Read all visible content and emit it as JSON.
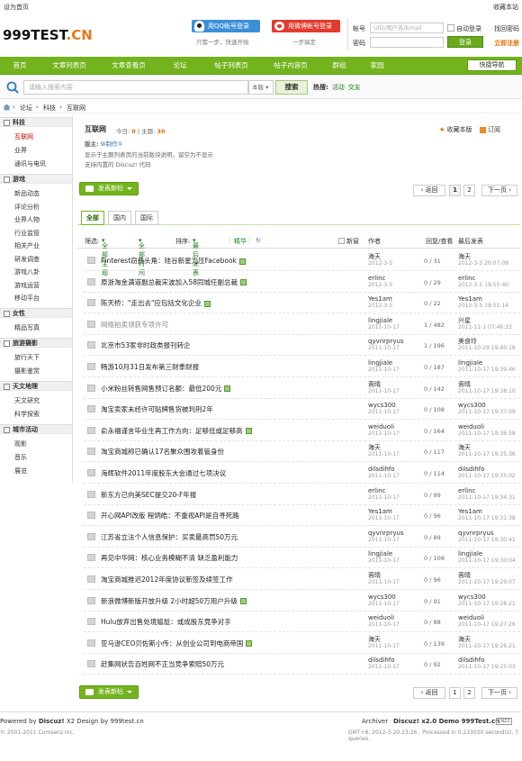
{
  "topbar": {
    "set_home": "设为首页",
    "bookmark": "收藏本站"
  },
  "logo": {
    "main": "999TEST",
    "suffix": ".CN"
  },
  "social": {
    "qq_label": "用QQ帐号登录",
    "qq_sub": "只需一步，快速开始",
    "weibo_label": "用微博帐号登录",
    "weibo_sub": "一步搞定"
  },
  "login": {
    "account_label": "帐号",
    "account_placeholder": "UID/用户名/Email",
    "autologin": "自动登录",
    "forgot": "找回密码",
    "password_label": "密码",
    "login_btn": "登录",
    "register": "立即注册"
  },
  "nav": {
    "items": [
      "首页",
      "文章列表页",
      "文章查看页",
      "论坛",
      "帖子列表页",
      "帖子内容页",
      "群组",
      "家园"
    ],
    "quick": "快捷导航"
  },
  "search": {
    "placeholder": "请输入搜索内容",
    "scope": "本版",
    "button": "搜索",
    "hot_label": "热搜:",
    "hot": [
      "活动",
      "交友"
    ]
  },
  "breadcrumb": [
    "论坛",
    "科技",
    "互联网"
  ],
  "sidebar": {
    "groups": [
      {
        "title": "科技",
        "items": [
          "互联网",
          "业界",
          "通讯与电讯"
        ]
      },
      {
        "title": "游戏",
        "items": [
          "新品动态",
          "评论分析",
          "业界人物",
          "行业监管",
          "相关产业",
          "研发调查",
          "游戏八卦",
          "游戏运营",
          "移动平台"
        ]
      },
      {
        "title": "女性",
        "items": [
          "精品写真"
        ]
      },
      {
        "title": "旅游摄影",
        "items": [
          "旅行天下",
          "摄影鉴赏"
        ]
      },
      {
        "title": "天文地理",
        "items": [
          "天文研究",
          "科学探索"
        ]
      },
      {
        "title": "城市活动",
        "items": [
          "观影",
          "音乐",
          "展览"
        ]
      }
    ]
  },
  "forum": {
    "name": "互联网",
    "today_label": "今日:",
    "today": "0",
    "topics_label": "主题:",
    "topics": "30",
    "mod_label": "版主:",
    "mod": "9i制作①",
    "desc1": "显示于主题列表页的当前版块说明，留空为不显示",
    "desc2": "支持内置的 Discuz! 代码",
    "fav": "收藏本版",
    "rss": "订阅"
  },
  "actions": {
    "new_post": "发表新帖",
    "back": "返回",
    "page1": "1",
    "page2": "2",
    "next": "下一页"
  },
  "tabs": [
    "全部",
    "国内",
    "国际"
  ],
  "filter": {
    "label": "筛选:",
    "all_topics": "全部主题",
    "all_time": "全部时间",
    "sort_label": "排序:",
    "sort": "最后发表",
    "digest": "精华",
    "new_window": "新窗",
    "col_author": "作者",
    "col_replies": "回复/查看",
    "col_last": "最后发表"
  },
  "threads": [
    {
      "title": "Pinterest窃费头角：硅谷新星力压Facebook",
      "att": true,
      "grey": false,
      "author": "海天",
      "adate": "2012-3-5",
      "count": "0 / 31",
      "last": "海天",
      "ldate": "2012-3-5 20:07:08"
    },
    {
      "title": "原浙淘金满道副总裁宋波加入58同城任副总裁",
      "att": true,
      "grey": false,
      "author": "erlinc",
      "adate": "2012-3-5",
      "count": "0 / 29",
      "last": "erlinc",
      "ldate": "2012-3-5 19:55:40"
    },
    {
      "title": "陈天桥：\"走出去\"应包括文化企业",
      "att": true,
      "grey": false,
      "author": "Yes1am",
      "adate": "2012-3-5",
      "count": "0 / 22",
      "last": "Yes1am",
      "ldate": "2012-3-5 19:51:14"
    },
    {
      "title": "网络拍卖领获专项许可",
      "att": false,
      "grey": true,
      "author": "lingjiale",
      "adate": "2011-10-17",
      "count": "1 / 482",
      "last": "兴星",
      "ldate": "2011-11-1 07:46:33"
    },
    {
      "title": "北京市53家非时政类报刊转企",
      "att": false,
      "grey": false,
      "author": "qyvnrpryus",
      "adate": "2011-10-17",
      "count": "1 / 196",
      "last": "美食玲",
      "ldate": "2011-10-29 19:40:18"
    },
    {
      "title": "畅游10月31日发布第三财季财报",
      "att": false,
      "grey": false,
      "author": "lingjiale",
      "adate": "2011-10-17",
      "count": "0 / 187",
      "last": "lingjiale",
      "ldate": "2011-10-17 19:39:46"
    },
    {
      "title": "小米粉丝转售网售预订名额：最低200元",
      "att": true,
      "grey": false,
      "author": "蓉晴",
      "adate": "2011-10-17",
      "count": "0 / 142",
      "last": "蓉晴",
      "ldate": "2011-10-17 19:38:10"
    },
    {
      "title": "淘宝卖家未经许可贴牌售货被判刑2年",
      "att": false,
      "grey": false,
      "author": "wycs300",
      "adate": "2011-10-17",
      "count": "0 / 108",
      "last": "wycs300",
      "ldate": "2011-10-17 19:37:09"
    },
    {
      "title": "俞永福谨言毕业生再工作方向：足够低或足够高",
      "att": true,
      "grey": false,
      "author": "weiduoli",
      "adate": "2011-10-17",
      "count": "0 / 164",
      "last": "weiduoli",
      "ldate": "2011-10-17 19:36:58"
    },
    {
      "title": "淘宝商城称已确认17名聚众围攻着管身份",
      "att": false,
      "grey": false,
      "author": "海天",
      "adate": "2011-10-17",
      "count": "0 / 117",
      "last": "海天",
      "ldate": "2011-10-17 19:35:36"
    },
    {
      "title": "海辉软件2011年度股东大会通过七项决议",
      "att": false,
      "grey": false,
      "author": "dilsdihfo",
      "adate": "2011-10-17",
      "count": "0 / 114",
      "last": "dilsdihfo",
      "ldate": "2011-10-17 19:35:02"
    },
    {
      "title": "新东方已向美SEC提交20-F年报",
      "att": false,
      "grey": false,
      "author": "erlinc",
      "adate": "2011-10-17",
      "count": "0 / 99",
      "last": "erlinc",
      "ldate": "2011-10-17 19:34:31"
    },
    {
      "title": "开心网API改版 程炳皓：不重视API是自寻死路",
      "att": false,
      "grey": false,
      "author": "Yes1am",
      "adate": "2011-10-17",
      "count": "0 / 96",
      "last": "Yes1am",
      "ldate": "2011-10-17 19:31:38"
    },
    {
      "title": "江苏省立法个人信息保护：买卖最高罚50万元",
      "att": false,
      "grey": false,
      "author": "qyvnrpryus",
      "adate": "2011-10-17",
      "count": "0 / 89",
      "last": "qyvnrpryus",
      "ldate": "2011-10-17 19:30:41"
    },
    {
      "title": "再见中华网：核心业务模糊不清 缺乏盈利能力",
      "att": false,
      "grey": false,
      "author": "lingjiale",
      "adate": "2011-10-17",
      "count": "0 / 108",
      "last": "lingjiale",
      "ldate": "2011-10-17 19:30:04"
    },
    {
      "title": "淘宝商城推迟2012年度协议新签及续签工作",
      "att": false,
      "grey": false,
      "author": "蓉晴",
      "adate": "2011-10-17",
      "count": "0 / 96",
      "last": "蓉晴",
      "ldate": "2011-10-17 19:29:07"
    },
    {
      "title": "新浪微博新版开放升级 2小时超50万用户升级",
      "att": true,
      "grey": false,
      "author": "wycs300",
      "adate": "2011-10-17",
      "count": "0 / 91",
      "last": "wycs300",
      "ldate": "2011-10-17 19:28:21"
    },
    {
      "title": "Hulu放弃出售处境尴尬：或成股东竞争对手",
      "att": false,
      "grey": false,
      "author": "weiduoli",
      "adate": "2011-10-17",
      "count": "0 / 88",
      "last": "weiduoli",
      "ldate": "2011-10-17 19:27:26"
    },
    {
      "title": "亚马逊CEO贝佐斯小传：从创业公司到电商帝国",
      "att": true,
      "grey": false,
      "author": "海天",
      "adate": "2011-10-17",
      "count": "0 / 139",
      "last": "海天",
      "ldate": "2011-10-17 19:26:21"
    },
    {
      "title": "赶集网状告百姓网不正当竞争索赔50万元",
      "att": false,
      "grey": false,
      "author": "dilsdihfo",
      "adate": "2011-10-17",
      "count": "0 / 92",
      "last": "dilsdihfo",
      "ldate": "2011-10-17 19:25:03"
    }
  ],
  "footer": {
    "powered": "Powered by",
    "discuz": "Discuz!",
    "design": "X2 Design by 999test.cn",
    "copyright": "© 2001-2011 Comsenz Inc.",
    "archiver": "Archiver",
    "demo": "Discuz! x2.0 Demo 999Test.cn",
    "badge": "CNZZ",
    "gmt": "GMT+8, 2012-3-20 23:26 , Processed in 0.233030 second(s), 7 queries ."
  },
  "colors": {
    "nav_green": "#73b41e",
    "accent_orange": "#e06d00",
    "qq_blue": "#3b8fd9",
    "weibo_red": "#e23b2e"
  }
}
